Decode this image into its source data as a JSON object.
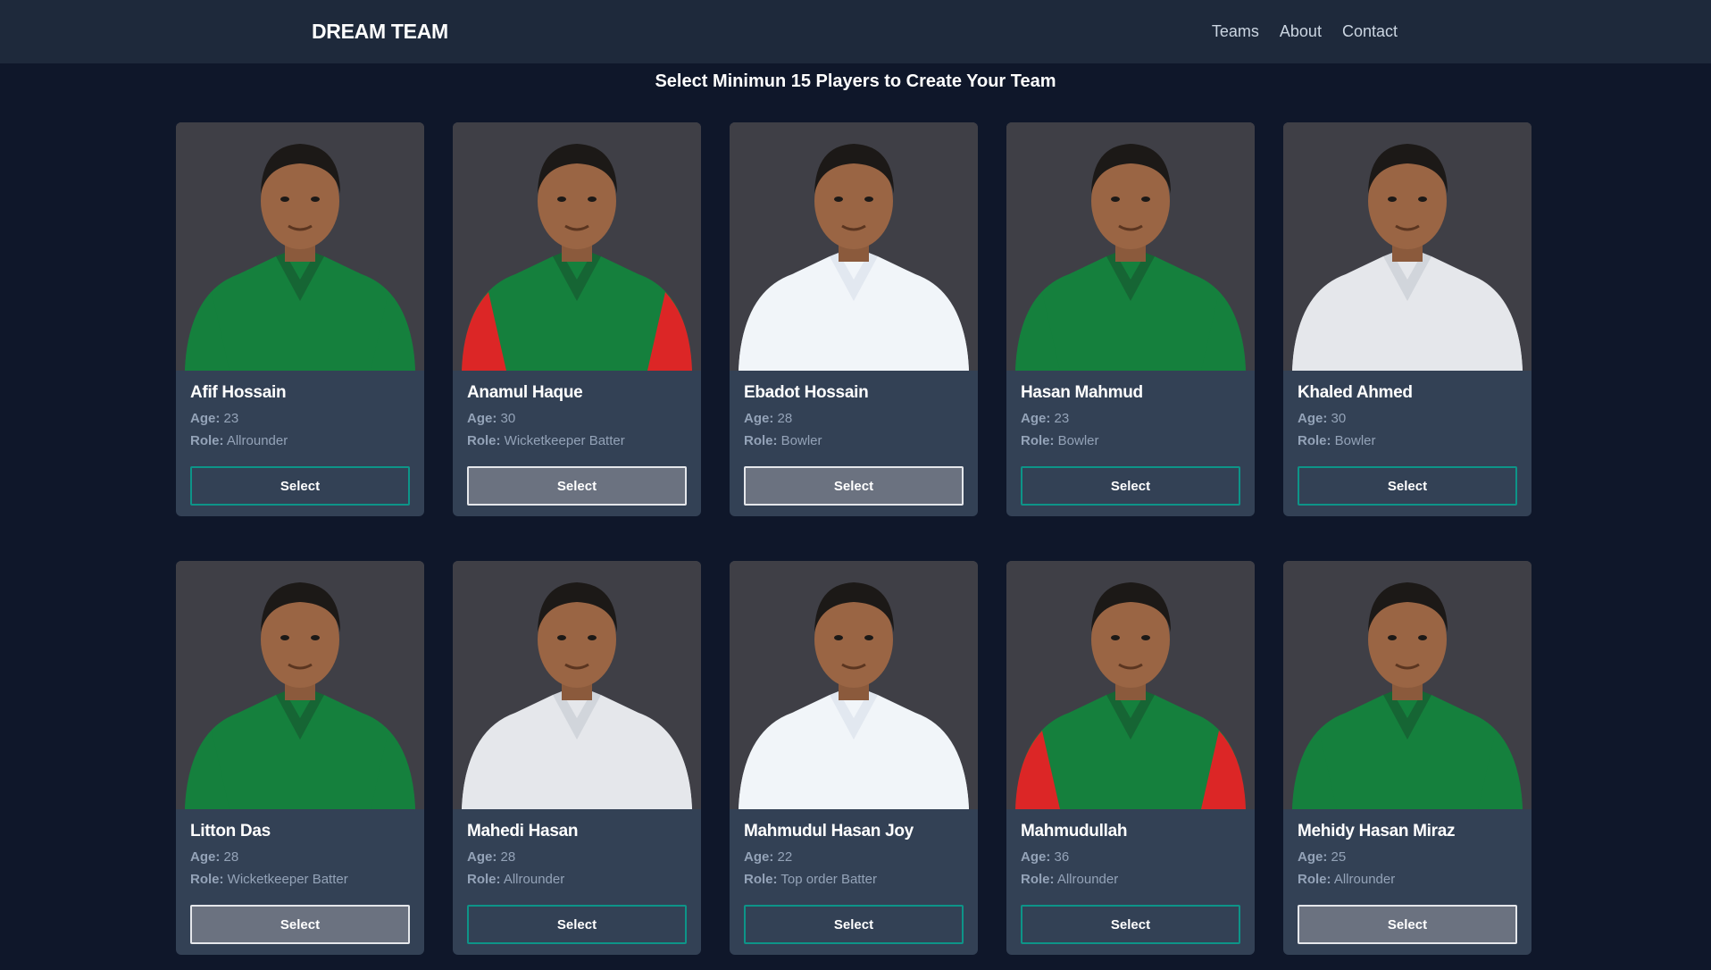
{
  "navbar": {
    "brand": "DREAM TEAM",
    "links": [
      "Teams",
      "About",
      "Contact"
    ]
  },
  "headline": "Select Minimun 15 Players to Create Your Team",
  "labels": {
    "age": "Age:",
    "role": "Role:"
  },
  "players": [
    {
      "name": "Afif Hossain",
      "age": "23",
      "role": "Allrounder",
      "button": "Select",
      "selected": false,
      "jersey": "green"
    },
    {
      "name": "Anamul Haque",
      "age": "30",
      "role": "Wicketkeeper Batter",
      "button": "Select",
      "selected": true,
      "jersey": "red-green"
    },
    {
      "name": "Ebadot Hossain",
      "age": "28",
      "role": "Bowler",
      "button": "Select",
      "selected": true,
      "jersey": "white"
    },
    {
      "name": "Hasan Mahmud",
      "age": "23",
      "role": "Bowler",
      "button": "Select",
      "selected": false,
      "jersey": "green"
    },
    {
      "name": "Khaled Ahmed",
      "age": "30",
      "role": "Bowler",
      "button": "Select",
      "selected": false,
      "jersey": "light"
    },
    {
      "name": "Litton Das",
      "age": "28",
      "role": "Wicketkeeper Batter",
      "button": "Select",
      "selected": true,
      "jersey": "green"
    },
    {
      "name": "Mahedi Hasan",
      "age": "28",
      "role": "Allrounder",
      "button": "Select",
      "selected": false,
      "jersey": "light"
    },
    {
      "name": "Mahmudul Hasan Joy",
      "age": "22",
      "role": "Top order Batter",
      "button": "Select",
      "selected": false,
      "jersey": "white"
    },
    {
      "name": "Mahmudullah",
      "age": "36",
      "role": "Allrounder",
      "button": "Select",
      "selected": false,
      "jersey": "red-green"
    },
    {
      "name": "Mehidy Hasan Miraz",
      "age": "25",
      "role": "Allrounder",
      "button": "Select",
      "selected": true,
      "jersey": "green"
    }
  ],
  "colors": {
    "page_bg": "#0f172a",
    "navbar_bg": "#1e293b",
    "card_bg": "#334155",
    "photo_bg": "#3f3f46",
    "button_border": "#0d9488",
    "button_selected_bg": "#6b7280"
  }
}
